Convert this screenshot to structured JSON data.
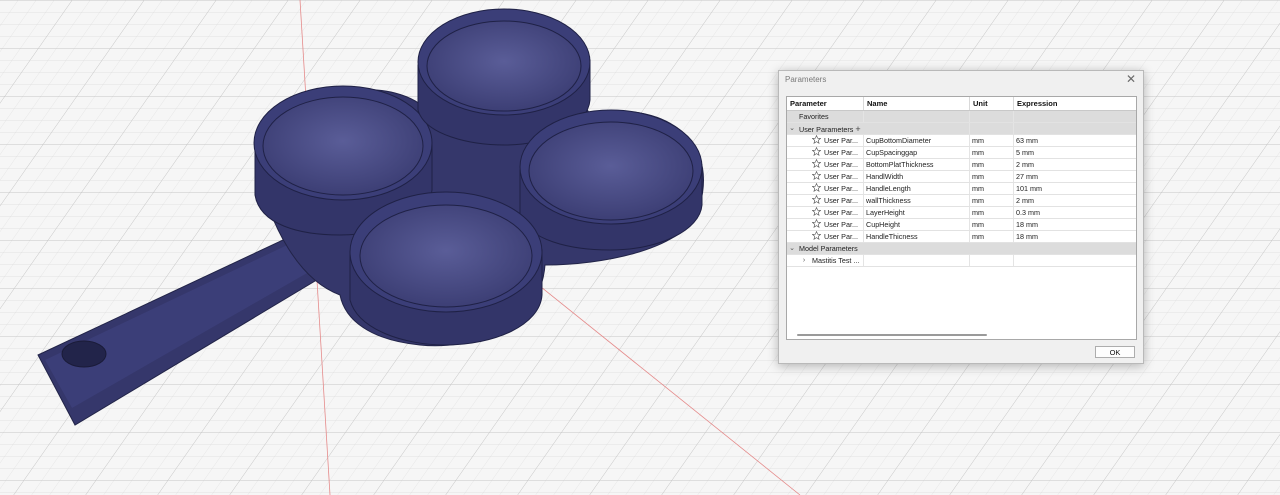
{
  "dialog": {
    "title": "Parameters",
    "ok_label": "OK",
    "columns": [
      "Parameter",
      "Name",
      "Unit",
      "Expression"
    ],
    "favorites_label": "Favorites",
    "user_parameters_label": "User Parameters",
    "user_parameters": [
      {
        "param": "User Par...",
        "name": "CupBottomDiameter",
        "unit": "mm",
        "expression": "63 mm"
      },
      {
        "param": "User Par...",
        "name": "CupSpacinggap",
        "unit": "mm",
        "expression": "5 mm"
      },
      {
        "param": "User Par...",
        "name": "BottomPlatThickness",
        "unit": "mm",
        "expression": "2 mm"
      },
      {
        "param": "User Par...",
        "name": "HandlWidth",
        "unit": "mm",
        "expression": "27 mm"
      },
      {
        "param": "User Par...",
        "name": "HandleLength",
        "unit": "mm",
        "expression": "101 mm"
      },
      {
        "param": "User Par...",
        "name": "wallThickness",
        "unit": "mm",
        "expression": "2 mm"
      },
      {
        "param": "User Par...",
        "name": "LayerHeight",
        "unit": "mm",
        "expression": "0.3 mm"
      },
      {
        "param": "User Par...",
        "name": "CupHeight",
        "unit": "mm",
        "expression": "18 mm"
      },
      {
        "param": "User Par...",
        "name": "HandleThicness",
        "unit": "mm",
        "expression": "18 mm"
      }
    ],
    "model_parameters_label": "Model Parameters",
    "model_component": "Mastitis Test ..."
  },
  "model": {
    "color": "#3a3c72"
  }
}
